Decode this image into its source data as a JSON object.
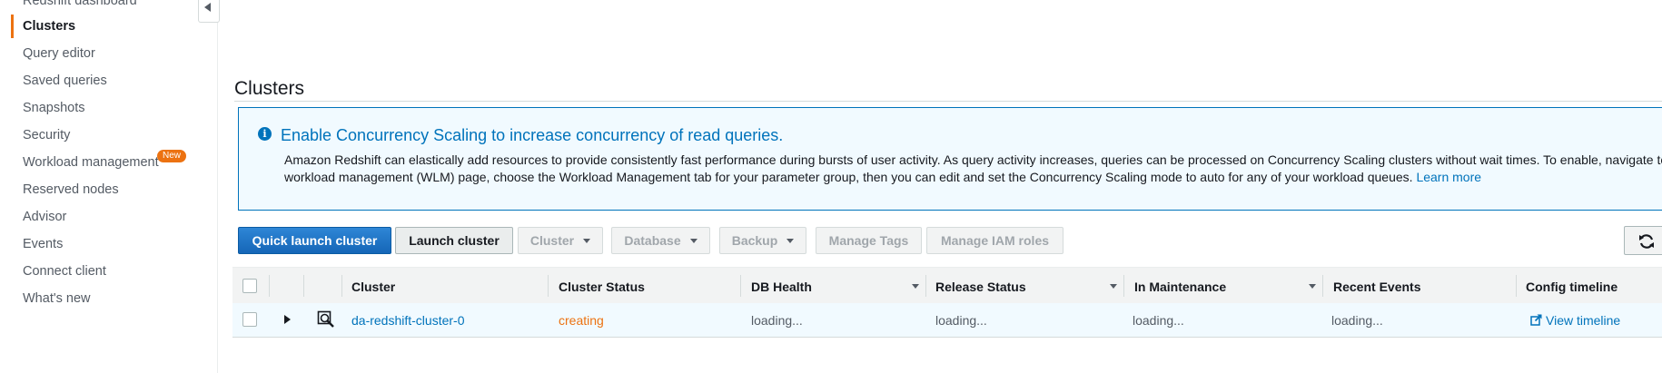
{
  "sidebar": {
    "items": [
      {
        "label": "Redshift dashboard"
      },
      {
        "label": "Clusters"
      },
      {
        "label": "Query editor"
      },
      {
        "label": "Saved queries"
      },
      {
        "label": "Snapshots"
      },
      {
        "label": "Security"
      },
      {
        "label": "Workload management"
      },
      {
        "label": "Reserved nodes"
      },
      {
        "label": "Advisor"
      },
      {
        "label": "Events"
      },
      {
        "label": "Connect client"
      },
      {
        "label": "What's new"
      }
    ],
    "new_badge": "New",
    "accent_color": "#ec7211"
  },
  "main": {
    "title": "Clusters",
    "info": {
      "icon": "info-icon",
      "title": "Enable Concurrency Scaling to increase concurrency of read queries.",
      "body": "Amazon Redshift can elastically add resources to provide consistently fast performance during bursts of user activity. As query activity increases, queries can be processed on Concurrency Scaling clusters without wait times. To enable, navigate to the workload management (WLM) page, choose the Workload Management tab for your parameter group, then you can edit and set the Concurrency Scaling mode to auto for any of your workload queues.",
      "link": "Learn more"
    },
    "toolbar": {
      "quick_launch": "Quick launch cluster",
      "launch": "Launch cluster",
      "cluster": "Cluster",
      "database": "Database",
      "backup": "Backup",
      "manage_tags": "Manage Tags",
      "manage_iam": "Manage IAM roles",
      "refresh_icon": "refresh-icon"
    },
    "table": {
      "headers": [
        "Cluster",
        "Cluster Status",
        "DB Health",
        "Release Status",
        "In Maintenance",
        "Recent Events",
        "Config timeline"
      ],
      "rows": [
        {
          "cluster": "da-redshift-cluster-0",
          "status": "creating",
          "db_health": "loading...",
          "release_status": "loading...",
          "in_maintenance": "loading...",
          "recent_events": "loading...",
          "config_timeline": "View timeline"
        }
      ]
    }
  }
}
